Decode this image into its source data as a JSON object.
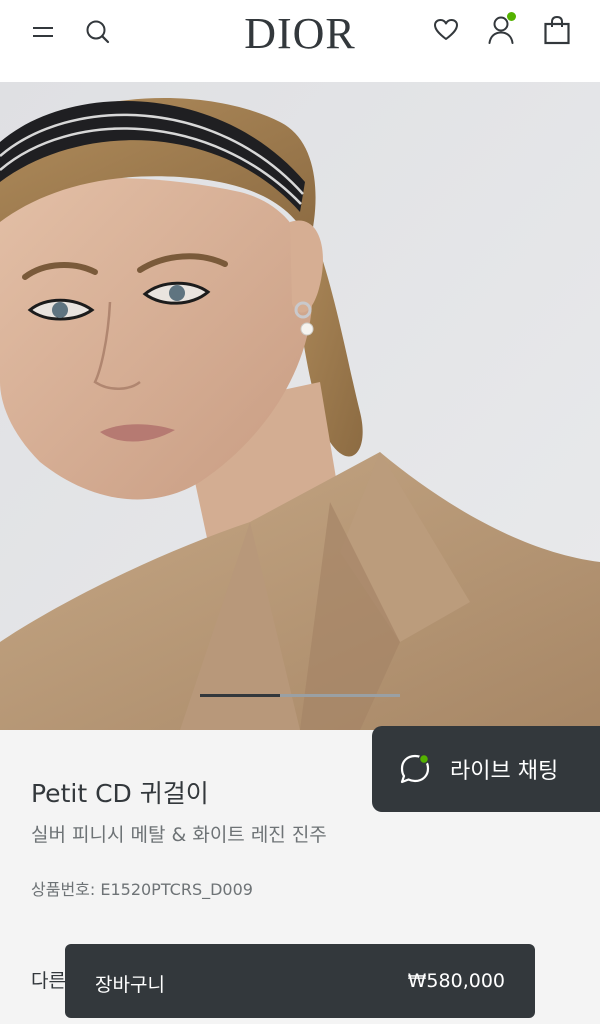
{
  "header": {
    "logo_text": "DIOR",
    "icons": [
      "menu-icon",
      "search-icon",
      "heart-icon",
      "user-icon",
      "shopping-bag-icon"
    ],
    "account_indicator_color": "#54b200"
  },
  "hero": {
    "image_count_progress": 0.4
  },
  "product": {
    "name": "Petit CD 귀걸이",
    "description": "실버 피니시 메탈 & 화이트 레진 진주",
    "reference": "상품번호: E1520PTCRS_D009",
    "other_label": "다른"
  },
  "live_chat": {
    "label": "라이브 채팅",
    "indicator_color": "#54b200"
  },
  "cart_bar": {
    "label": "장바구니",
    "price": "₩580,000"
  },
  "colors": {
    "brand_dark": "#33383c",
    "background": "#f4f4f4"
  }
}
